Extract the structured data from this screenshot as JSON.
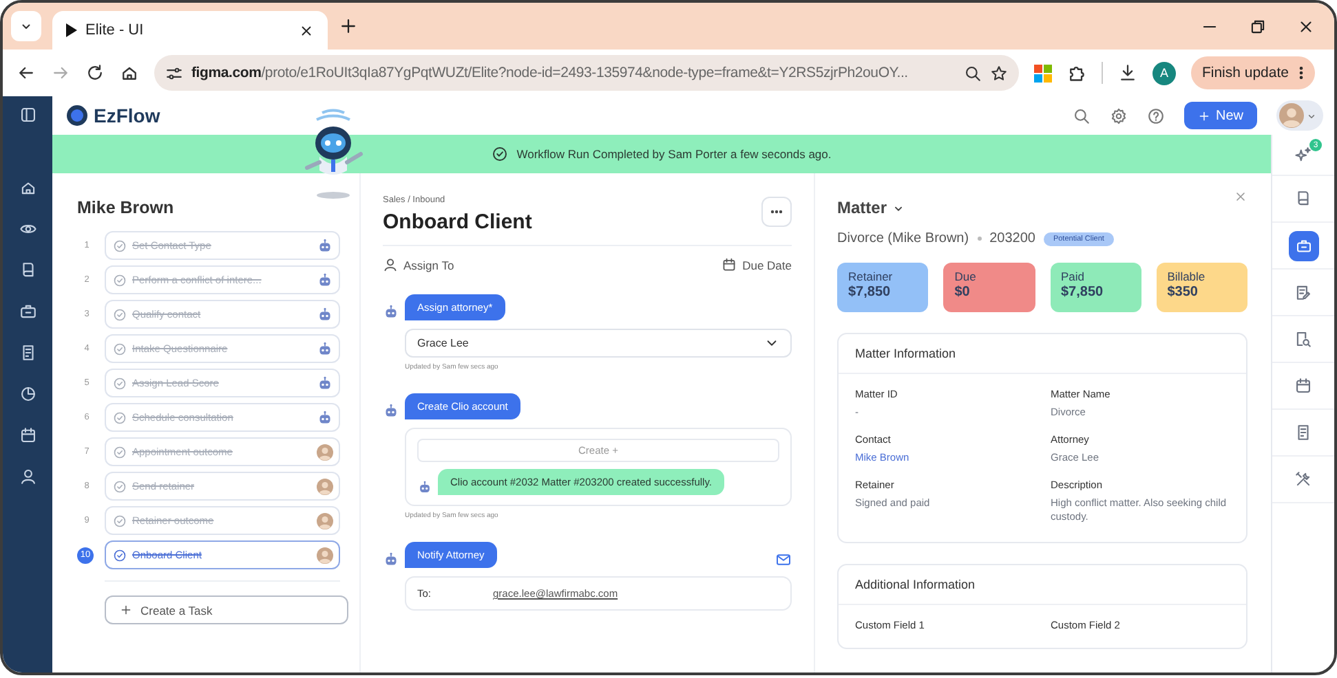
{
  "browser": {
    "tabs": [
      {
        "title": "Elite - UI",
        "selected": true
      }
    ],
    "url_domain": "figma.com",
    "url_path": "/proto/e1RoUIt3qIa87YgPqtWUZt/Elite?node-id=2493-135974&node-type=frame&t=Y2RS5zjrPh2ouOY...",
    "profile_initial": "A",
    "update_button": "Finish update"
  },
  "app": {
    "logo": "EzFlow",
    "new_button": "New"
  },
  "banner": "Workflow Run Completed by Sam Porter a few seconds ago.",
  "tasks": {
    "contact": "Mike Brown",
    "create_button": "Create a Task",
    "items": [
      {
        "number": "1",
        "label": "Set Contact Type",
        "done": true,
        "selected": false,
        "kind": "bot"
      },
      {
        "number": "2",
        "label": "Perform a conflict of intere...",
        "done": true,
        "selected": false,
        "kind": "bot"
      },
      {
        "number": "3",
        "label": "Qualify contact",
        "done": true,
        "selected": false,
        "kind": "bot"
      },
      {
        "number": "4",
        "label": "Intake Questionnaire",
        "done": true,
        "selected": false,
        "kind": "bot"
      },
      {
        "number": "5",
        "label": "Assign Lead Score",
        "done": true,
        "selected": false,
        "kind": "bot"
      },
      {
        "number": "6",
        "label": "Schedule consultation",
        "done": true,
        "selected": false,
        "kind": "bot"
      },
      {
        "number": "7",
        "label": "Appointment outcome",
        "done": true,
        "selected": false,
        "kind": "person"
      },
      {
        "number": "8",
        "label": "Send retainer",
        "done": true,
        "selected": false,
        "kind": "person"
      },
      {
        "number": "9",
        "label": "Retainer outcome",
        "done": true,
        "selected": false,
        "kind": "person"
      },
      {
        "number": "10",
        "label": "Onboard Client",
        "done": true,
        "selected": true,
        "kind": "person"
      }
    ]
  },
  "task": {
    "breadcrumb": "Sales / Inbound",
    "title": "Onboard Client",
    "assign_label": "Assign To",
    "due_label": "Due Date",
    "steps": [
      {
        "kind": "select",
        "label": "Assign attorney*",
        "value": "Grace Lee",
        "note": "Updated by Sam few secs ago"
      },
      {
        "kind": "create",
        "label": "Create Clio account",
        "create_label": "Create +",
        "message": "Clio account #2032 Matter #203200 created successfully.",
        "note": "Updated by Sam few secs ago"
      },
      {
        "kind": "email",
        "label": "Notify Attorney",
        "to_label": "To:",
        "to_value": "grace.lee@lawfirmabc.com"
      }
    ]
  },
  "matter": {
    "title": "Matter",
    "name": "Divorce (Mike Brown)",
    "number": "203200",
    "status": "Potential Client",
    "cards": [
      {
        "label": "Retainer",
        "value": "$7,850",
        "color": "#93c0f7"
      },
      {
        "label": "Due",
        "value": "$0",
        "color": "#f08a88"
      },
      {
        "label": "Paid",
        "value": "$7,850",
        "color": "#8eeab8"
      },
      {
        "label": "Billable",
        "value": "$350",
        "color": "#fdd88a"
      }
    ],
    "info": {
      "title": "Matter Information",
      "fields": [
        {
          "label": "Matter ID",
          "value": "-",
          "link": false
        },
        {
          "label": "Matter Name",
          "value": "Divorce",
          "link": false
        },
        {
          "label": "Contact",
          "value": "Mike Brown",
          "link": true
        },
        {
          "label": "Attorney",
          "value": "Grace Lee",
          "link": false
        },
        {
          "label": "Retainer",
          "value": "Signed and paid",
          "link": false
        },
        {
          "label": "Description",
          "value": "High conflict matter. Also seeking child custody.",
          "link": false
        }
      ]
    },
    "additional": {
      "title": "Additional Information",
      "fields": [
        {
          "label": "Custom Field 1"
        },
        {
          "label": "Custom Field 2"
        }
      ]
    }
  },
  "rail": [
    {
      "kind": "sparkle",
      "badge": "3",
      "selected": false
    },
    {
      "kind": "book",
      "selected": false
    },
    {
      "kind": "briefcase",
      "selected": true
    },
    {
      "kind": "note",
      "selected": false
    },
    {
      "kind": "search-doc",
      "selected": false
    },
    {
      "kind": "calendar",
      "selected": false
    },
    {
      "kind": "document",
      "selected": false
    },
    {
      "kind": "tools",
      "selected": false
    }
  ]
}
